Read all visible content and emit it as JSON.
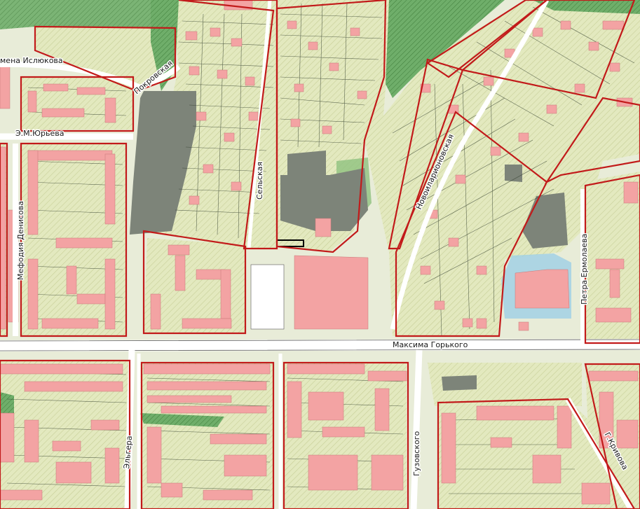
{
  "map": {
    "streets": {
      "maksima_gorkogo": "Максима Горького",
      "novoilarionovskaya": "Новоиларионовская",
      "selskaya": "Сельская",
      "pokrovskaya": "Покровская",
      "imena_islyukova": "мена Ислюкова",
      "e_m_yurieva": "Э.М.Юрьева",
      "mefodiya_denisova": "Мефодия Денисова",
      "petra_ermolaeva": "Петра Ермолаева",
      "elgera": "Эльгера",
      "guzovskogo": "Гузовского",
      "g_krivova": "Г.Кривова"
    },
    "colors": {
      "background": "#e8ecd8",
      "residential_hatch": "#dfe6b8",
      "building": "#f3a3a3",
      "building_outline": "#c97878",
      "forest": "#6fae6a",
      "industrial": "#7d8479",
      "zone_boundary": "#c21a1a",
      "road": "#f4f4f4",
      "water": "#9ed0e6"
    }
  }
}
